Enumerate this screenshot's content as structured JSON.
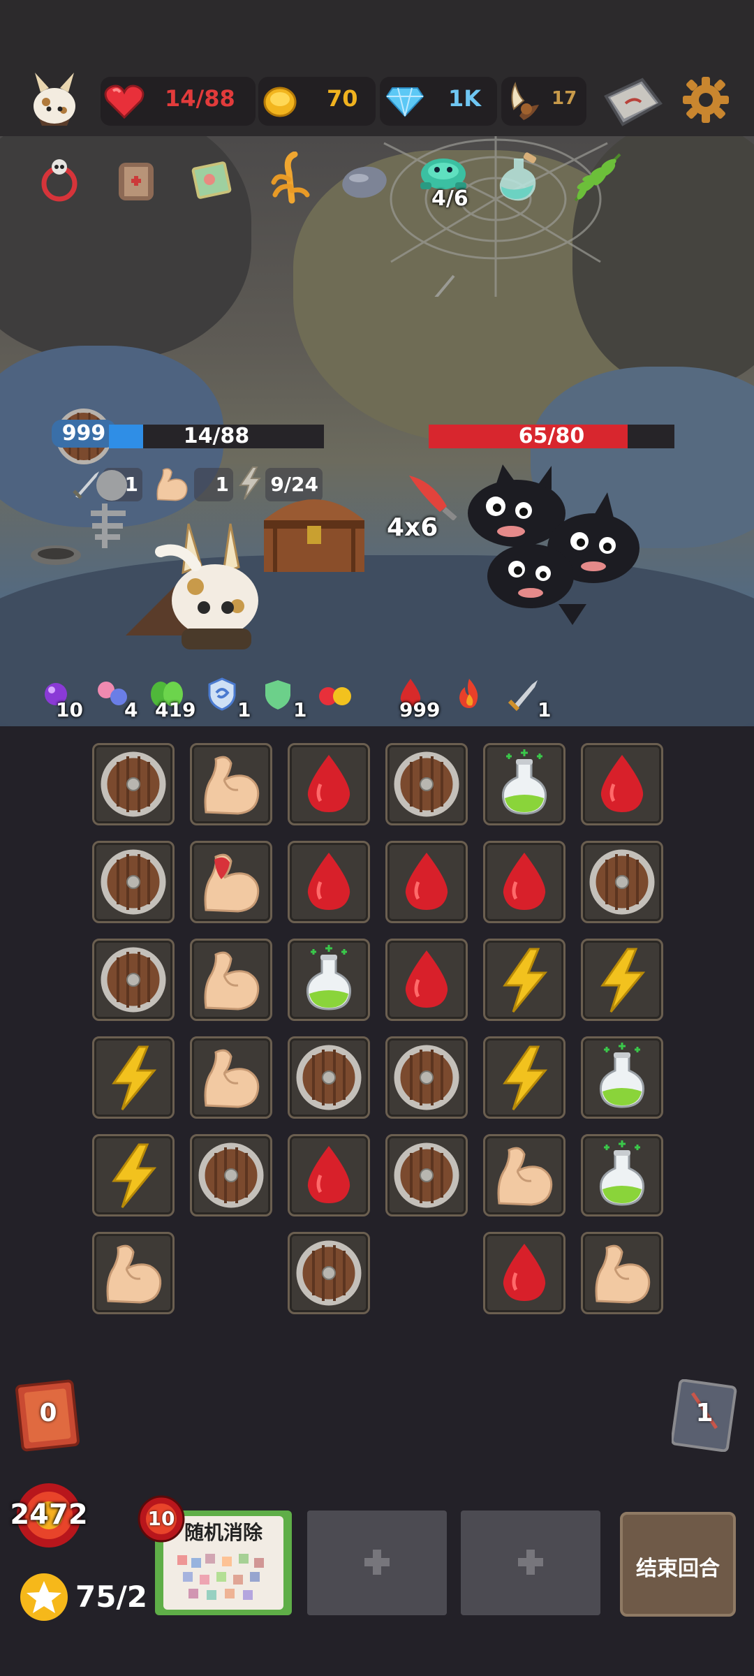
{
  "top_bar": {
    "hp": "14/88",
    "gold": "70",
    "gems": "1K",
    "horns": "17",
    "icons": [
      "avatar-icon",
      "heart-icon",
      "coin-icon",
      "diamond-icon",
      "horn-icon",
      "map-icon",
      "gear-icon"
    ]
  },
  "relics": {
    "items": [
      "skull-ring-icon",
      "bandage-scroll-icon",
      "card-pack-icon",
      "claw-icon",
      "stone-icon",
      "turtle-helmet-icon",
      "potion-bottle-icon",
      "fern-leaf-icon"
    ],
    "turtle_count": "4/6"
  },
  "player": {
    "shield": "999",
    "hp": "14/88",
    "hp_ratio": 0.16,
    "attack": "1",
    "strength": "1",
    "energy": "9/24"
  },
  "enemy": {
    "hp": "65/80",
    "hp_ratio": 0.81,
    "intent": "4x6"
  },
  "buffs": [
    {
      "icon": "purple-orb-icon",
      "value": "10"
    },
    {
      "icon": "gem-pair-icon",
      "value": "4"
    },
    {
      "icon": "green-leaf-icon",
      "value": "419"
    },
    {
      "icon": "shield-swirl-icon",
      "value": "1"
    },
    {
      "icon": "green-shield-icon",
      "value": "1"
    },
    {
      "icon": "red-yellow-orbs-icon",
      "value": ""
    }
  ],
  "enemy_buffs": [
    {
      "icon": "blood-drop-icon",
      "value": "999"
    },
    {
      "icon": "flame-icon",
      "value": ""
    },
    {
      "icon": "sword-icon",
      "value": "1"
    }
  ],
  "board": [
    [
      "shield",
      "arm",
      "blood",
      "shield",
      "potion",
      "blood"
    ],
    [
      "shield",
      "arm-red",
      "blood",
      "blood",
      "blood",
      "shield"
    ],
    [
      "shield",
      "arm",
      "potion",
      "blood",
      "bolt",
      "bolt"
    ],
    [
      "bolt",
      "arm",
      "shield",
      "shield",
      "bolt",
      "potion"
    ],
    [
      "bolt",
      "shield",
      "blood",
      "shield",
      "arm",
      "potion"
    ],
    [
      "arm",
      "",
      "shield",
      "",
      "blood",
      "arm"
    ]
  ],
  "draw_pile": "0",
  "discard_pile": "1",
  "score": "2472",
  "card": {
    "cost": "10",
    "title": "随机消除"
  },
  "stars": "75/2",
  "end_turn_label": "结束回合",
  "colors": {
    "hp_red": "#e23b3b",
    "hp_blue": "#2f8ee6",
    "gold": "#f0b21f",
    "gem": "#6fc6f2",
    "background": "#232128"
  }
}
